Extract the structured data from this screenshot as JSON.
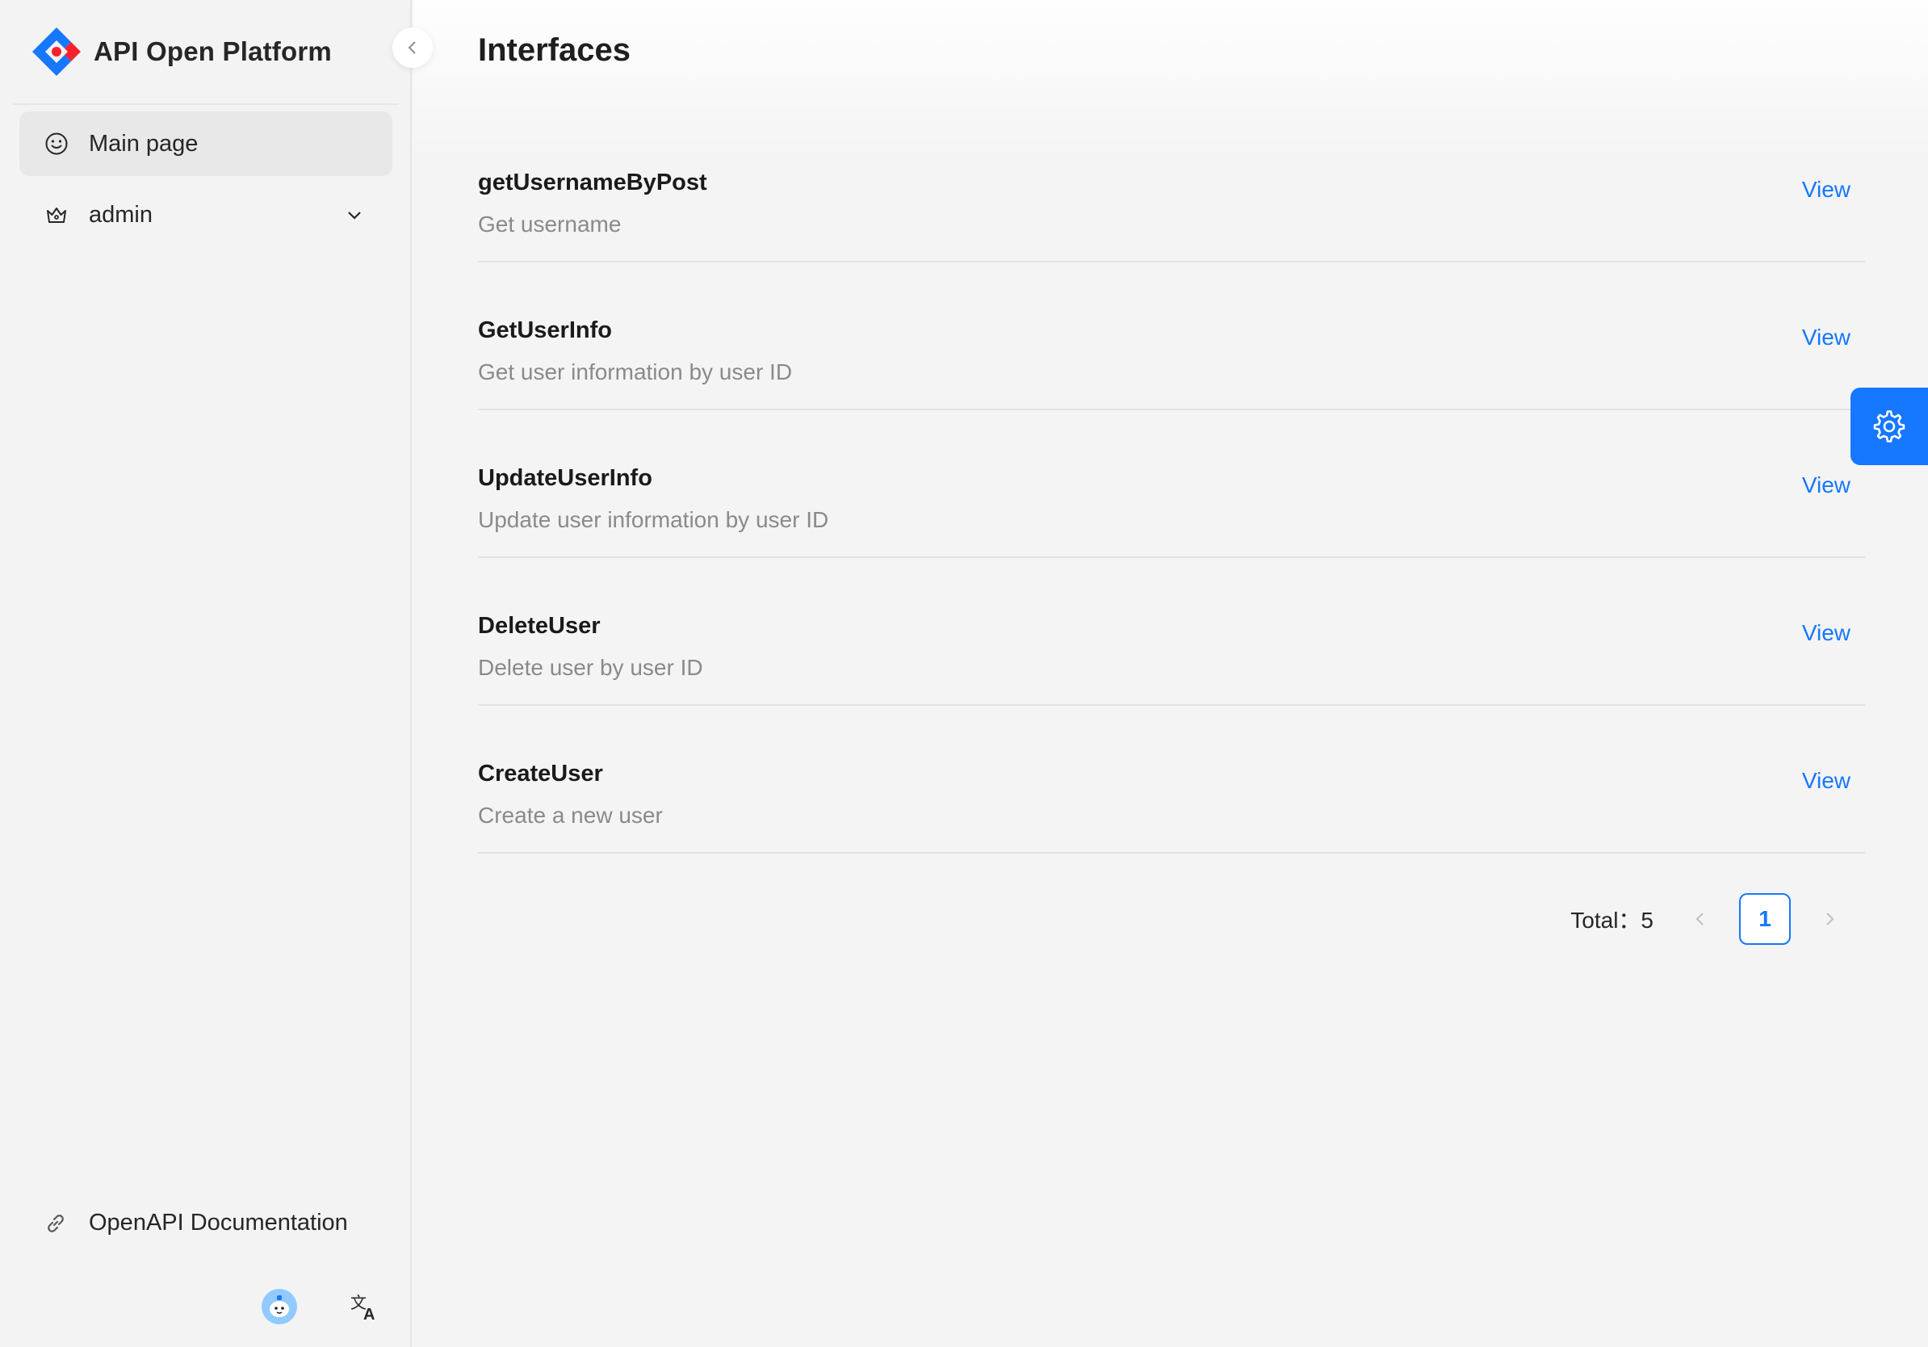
{
  "brand": {
    "title": "API Open Platform",
    "logo_icon": "antd-diamond-logo"
  },
  "sidebar": {
    "items": [
      {
        "label": "Main page",
        "icon": "smile-icon",
        "active": true
      },
      {
        "label": "admin",
        "icon": "crown-icon",
        "has_submenu": true
      }
    ],
    "footer_link": {
      "label": "OpenAPI Documentation",
      "icon": "link-icon"
    }
  },
  "main": {
    "title": "Interfaces",
    "items": [
      {
        "name": "getUsernameByPost",
        "description": "Get username",
        "action": "View"
      },
      {
        "name": "GetUserInfo",
        "description": "Get user information by user ID",
        "action": "View"
      },
      {
        "name": "UpdateUserInfo",
        "description": "Update user information by user ID",
        "action": "View"
      },
      {
        "name": "DeleteUser",
        "description": "Delete user by user ID",
        "action": "View"
      },
      {
        "name": "CreateUser",
        "description": "Create a new user",
        "action": "View"
      }
    ],
    "pagination": {
      "total_label": "Total：5",
      "current_page": "1"
    }
  },
  "colors": {
    "accent": "#1677ff",
    "logo_red": "#f5222d"
  }
}
